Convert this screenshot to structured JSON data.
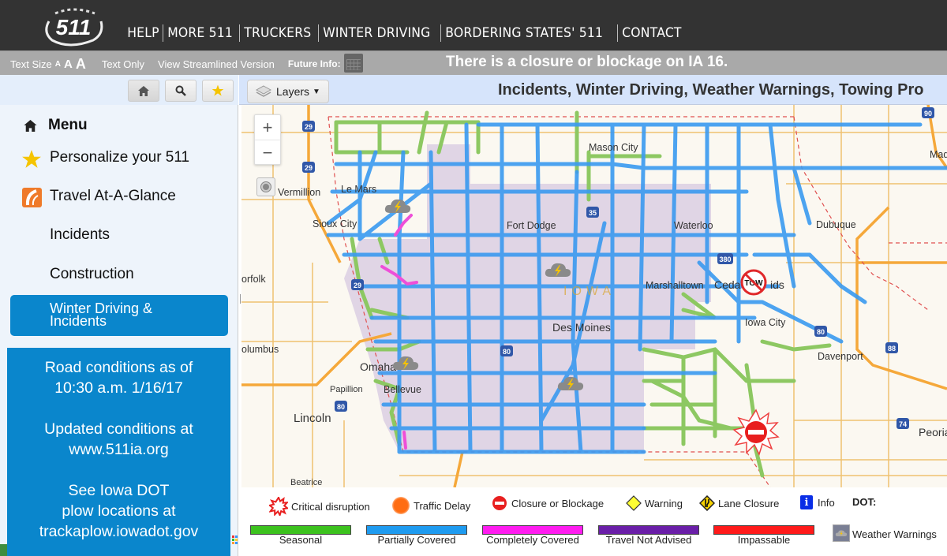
{
  "header": {
    "logo_text": "511",
    "nav": [
      "HELP",
      "MORE 511",
      "TRUCKERS",
      "WINTER DRIVING",
      "BORDERING STATES' 511",
      "CONTACT"
    ]
  },
  "subbar": {
    "text_size_label": "Text Size",
    "text_size_options": [
      "A",
      "A",
      "A"
    ],
    "text_only": "Text Only",
    "streamlined": "View Streamlined Version",
    "future_info": "Future Info:",
    "alert": "There is a closure or blockage on IA 16."
  },
  "sidebar": {
    "toolbar": [
      "home-icon",
      "search-icon",
      "star-icon"
    ],
    "menu_heading": "Menu",
    "items": [
      {
        "label": "Personalize your 511",
        "icon": "star-icon"
      },
      {
        "label": "Travel At-A-Glance",
        "icon": "road-icon"
      },
      {
        "label": "Incidents"
      },
      {
        "label": "Construction"
      }
    ],
    "active_item": {
      "line1": "Winter Driving &",
      "line2": "Incidents"
    },
    "info_box": {
      "p1_line1": "Road conditions as of",
      "p1_line2": "10:30 a.m. 1/16/17",
      "p2_line1": "Updated conditions at",
      "p2_line2": "www.511ia.org",
      "p3_line1": "See Iowa DOT",
      "p3_line2": "plow locations at",
      "p3_line3": "trackaplow.iowadot.gov"
    }
  },
  "map": {
    "layers_button": "Layers",
    "title": "Incidents, Winter Driving, Weather Warnings, Towing Pro",
    "zoom_in": "+",
    "zoom_out": "−",
    "state_label": "IOWA",
    "cities": [
      {
        "name": "Mason City"
      },
      {
        "name": "Le Mars"
      },
      {
        "name": "Sioux City"
      },
      {
        "name": "Vermillion"
      },
      {
        "name": "Fort Dodge"
      },
      {
        "name": "Waterloo"
      },
      {
        "name": "Dubuque"
      },
      {
        "name": "Mad"
      },
      {
        "name": "Marshalltown"
      },
      {
        "name": "Ceda"
      },
      {
        "name": "ids"
      },
      {
        "name": "Iowa City"
      },
      {
        "name": "Des Moines"
      },
      {
        "name": "Davenport"
      },
      {
        "name": "Omaha"
      },
      {
        "name": "Papillion"
      },
      {
        "name": "Bellevue"
      },
      {
        "name": "Lincoln"
      },
      {
        "name": "olumbus"
      },
      {
        "name": "orfolk"
      },
      {
        "name": "Beatrice"
      },
      {
        "name": "Peoria"
      }
    ],
    "highway_shields": [
      "29",
      "29",
      "29",
      "35",
      "80",
      "80",
      "80",
      "380",
      "88",
      "74",
      "90"
    ],
    "incident_icons": [
      "weather-warning",
      "weather-warning",
      "weather-warning",
      "weather-warning",
      "tow-prohibited",
      "critical-closure"
    ]
  },
  "legend": {
    "icons": [
      {
        "label": "Critical disruption",
        "icon": "critical-disruption-icon"
      },
      {
        "label": "Traffic Delay",
        "icon": "traffic-delay-icon"
      },
      {
        "label": "Closure or Blockage",
        "icon": "closure-icon"
      },
      {
        "label": "Warning",
        "icon": "warning-icon"
      },
      {
        "label": "Lane Closure",
        "icon": "lane-closure-icon"
      },
      {
        "label": "Info",
        "icon": "info-icon"
      }
    ],
    "dot_label": "DOT:",
    "bars": [
      {
        "label": "Seasonal",
        "color": "#3cc21e"
      },
      {
        "label": "Partially Covered",
        "color": "#1e9bf0"
      },
      {
        "label": "Completely Covered",
        "color": "#ff1cf0"
      },
      {
        "label": "Travel Not Advised",
        "color": "#6a1ea8"
      },
      {
        "label": "Impassable",
        "color": "#ff1a1a"
      }
    ],
    "weather_warnings": "Weather Warnings"
  },
  "colors": {
    "topbar": "#333333",
    "subbar": "#a9a9a9",
    "accent_blue": "#0a86cc",
    "road_partial": "#3a9af0",
    "road_seasonal": "#8dc862",
    "road_complete": "#ee4fd8",
    "weather_zone": "#ddd0e3"
  }
}
